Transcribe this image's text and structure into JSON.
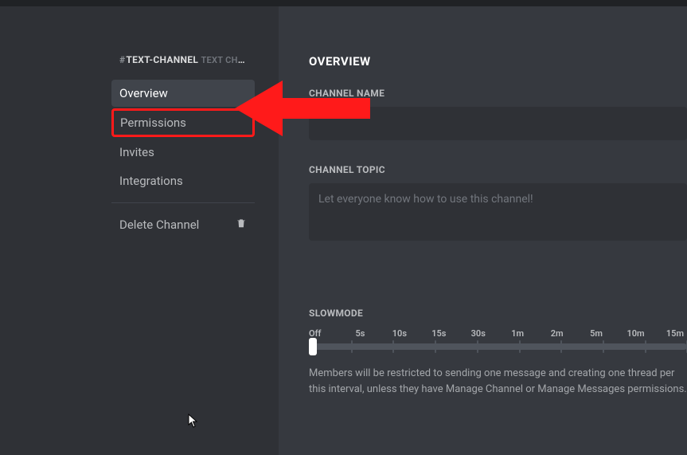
{
  "sidebar": {
    "channel_prefix": "#",
    "channel_name_upper": "TEXT-CHANNEL",
    "channel_sub": "TEXT CHA...",
    "items": [
      {
        "label": "Overview"
      },
      {
        "label": "Permissions"
      },
      {
        "label": "Invites"
      },
      {
        "label": "Integrations"
      }
    ],
    "delete_label": "Delete Channel"
  },
  "main": {
    "title": "OVERVIEW",
    "channel_name_label": "CHANNEL NAME",
    "channel_topic_label": "CHANNEL TOPIC",
    "channel_topic_placeholder": "Let everyone know how to use this channel!",
    "slowmode_label": "SLOWMODE",
    "slowmode_ticks": [
      "Off",
      "5s",
      "10s",
      "15s",
      "30s",
      "1m",
      "2m",
      "5m",
      "10m",
      "15m"
    ],
    "slowmode_helper": "Members will be restricted to sending one message and creating one thread per this interval, unless they have Manage Channel or Manage Messages permissions."
  }
}
